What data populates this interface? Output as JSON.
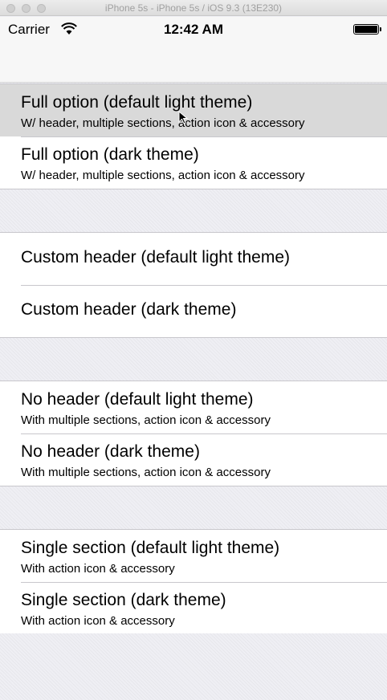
{
  "window": {
    "title": "iPhone 5s - iPhone 5s / iOS 9.3 (13E230)"
  },
  "status_bar": {
    "carrier": "Carrier",
    "time": "12:42 AM"
  },
  "sections": [
    {
      "rows": [
        {
          "title": "Full option (default light theme)",
          "subtitle": "W/ header, multiple sections, action icon & accessory",
          "selected": true
        },
        {
          "title": "Full option (dark theme)",
          "subtitle": "W/ header, multiple sections, action icon & accessory"
        }
      ]
    },
    {
      "rows": [
        {
          "title": "Custom header (default light theme)"
        },
        {
          "title": "Custom header (dark theme)"
        }
      ]
    },
    {
      "rows": [
        {
          "title": "No header (default light theme)",
          "subtitle": "With multiple sections, action icon & accessory"
        },
        {
          "title": "No header (dark theme)",
          "subtitle": "With multiple sections, action icon & accessory"
        }
      ]
    },
    {
      "rows": [
        {
          "title": "Single section (default light theme)",
          "subtitle": "With action icon & accessory"
        },
        {
          "title": "Single section (dark theme)",
          "subtitle": "With action icon & accessory"
        }
      ]
    }
  ]
}
